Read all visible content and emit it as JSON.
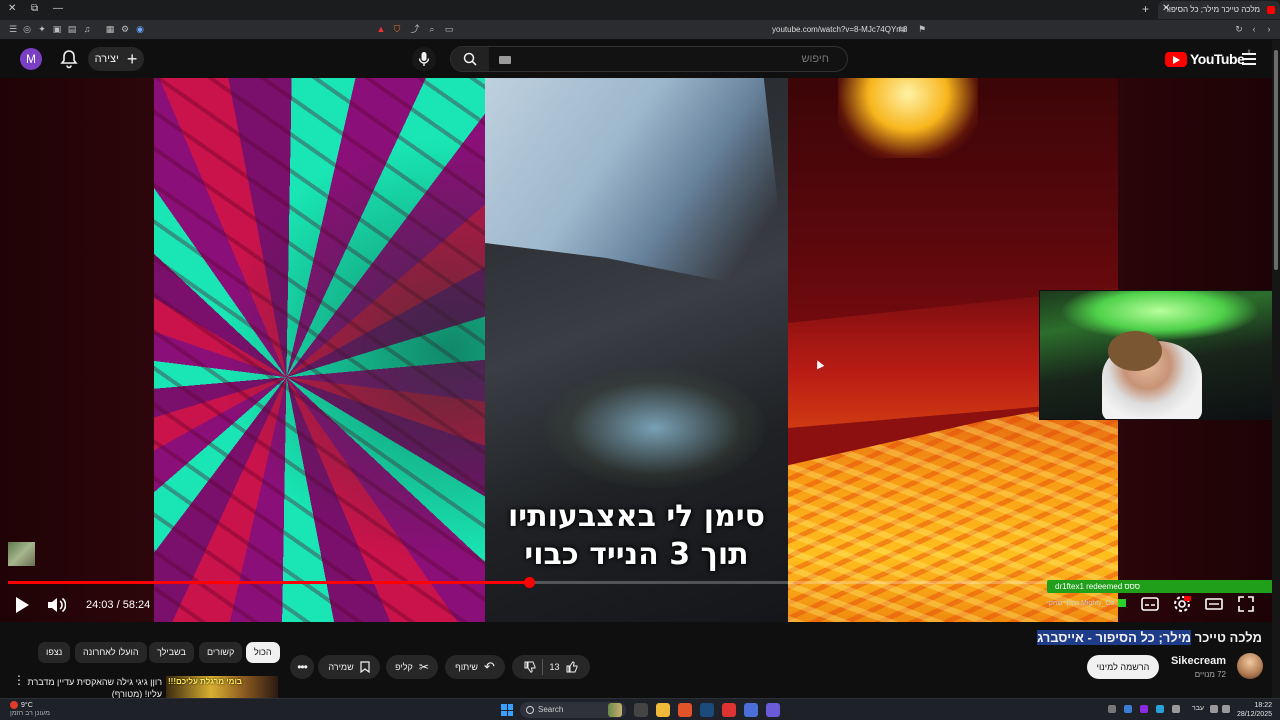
{
  "browser": {
    "tab_title": "מלכה טייכר מילר; כל הסיפור",
    "url": "youtube.com/watch?v=8-MJc74QYm8"
  },
  "header": {
    "avatar_letter": "M",
    "create_label": "יצירה",
    "search_placeholder": "חיפוש",
    "logo_text": "YouTube",
    "logo_country": "IL"
  },
  "player": {
    "subtitle_line1": "סימן לי באצבעותיו",
    "subtitle_line2": "תוך 3 הנייד כבוי",
    "time_current": "24:03",
    "time_separator": "/",
    "time_total": "58:24",
    "progress_fraction": 0.4118,
    "chat_message": "dr1ftex1 redeemed ססס",
    "chat_secondary": "Mighty_Oz  נהלך שחקי"
  },
  "video": {
    "title_plain": "מלכה טייכר ",
    "title_highlight": "מילר; כל הסיפור - אייסברג",
    "channel_name": "Sikecream",
    "subscribers": "72 מנויים",
    "subscribe_label": "הרשמה למינוי",
    "like_count": "13",
    "share_label": "שיתוף",
    "clip_label": "קליפ",
    "save_label": "שמירה"
  },
  "chips": [
    {
      "label": "הכול",
      "active": true
    },
    {
      "label": "קשורים",
      "active": false
    },
    {
      "label": "בשבילך",
      "active": false
    },
    {
      "label": "הועלו לאחרונה",
      "active": false
    },
    {
      "label": "נצפו",
      "active": false
    }
  ],
  "recommendation": {
    "title_line1": "רוןן גיגי גילה שהאקסית עדיין מדברת",
    "title_line2": "עליו! (מטורף)",
    "thumb_text": "בומי מרגלת עליכם!!!"
  },
  "taskbar": {
    "weather_temp": "9°C",
    "weather_desc": "מעונן רב הזמן",
    "search_label": "Search",
    "lang": "עבר",
    "time": "18:22",
    "date": "28/12/2025"
  },
  "colors": {
    "accent_red": "#ff0000",
    "chat_green": "#1f9f1a",
    "title_highlight": "#1f3c8a"
  }
}
